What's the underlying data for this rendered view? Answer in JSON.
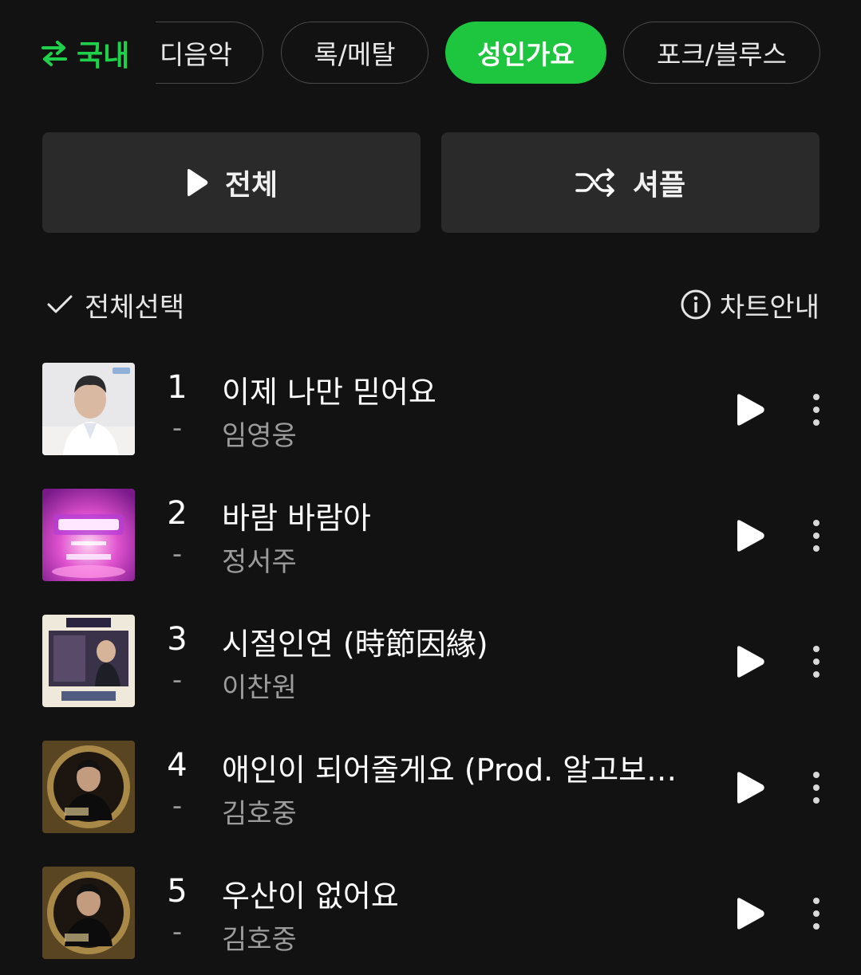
{
  "colors": {
    "background": "#121212",
    "accent_green": "#1ec63f",
    "region_green": "#1fd14a",
    "button_bg": "#2a2a2a",
    "secondary_text": "#9c9c9c"
  },
  "genre_bar": {
    "region_label": "국내",
    "region_icon": "swap-arrows-icon",
    "chips": [
      {
        "label": "디음악",
        "selected": false
      },
      {
        "label": "록/메탈",
        "selected": false
      },
      {
        "label": "성인가요",
        "selected": true
      },
      {
        "label": "포크/블루스",
        "selected": false
      }
    ]
  },
  "actions": {
    "play_all_label": "전체",
    "play_all_icon": "play-icon",
    "shuffle_label": "셔플",
    "shuffle_icon": "shuffle-icon"
  },
  "select_row": {
    "select_all_label": "전체선택",
    "select_all_icon": "check-icon",
    "chart_info_label": "차트안내",
    "chart_info_icon": "info-icon"
  },
  "tracks": [
    {
      "rank": "1",
      "change": "-",
      "title": "이제 나만 믿어요",
      "artist": "임영웅"
    },
    {
      "rank": "2",
      "change": "-",
      "title": "바람 바람아",
      "artist": "정서주"
    },
    {
      "rank": "3",
      "change": "-",
      "title": "시절인연 (時節因緣)",
      "artist": "이찬원"
    },
    {
      "rank": "4",
      "change": "-",
      "title": "애인이 되어줄게요 (Prod. 알고보니, 혼수상태)",
      "artist": "김호중"
    },
    {
      "rank": "5",
      "change": "-",
      "title": "우산이 없어요",
      "artist": "김호중"
    }
  ]
}
